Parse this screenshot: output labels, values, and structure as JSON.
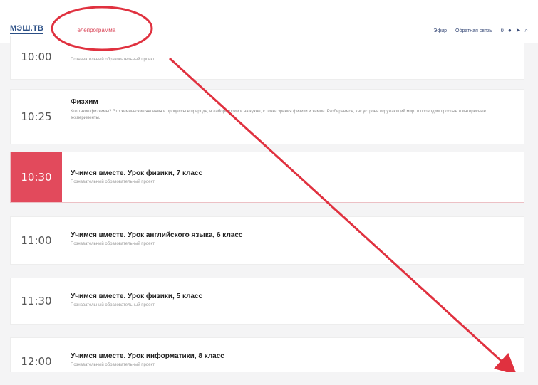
{
  "header": {
    "logo": "МЭШ.ТВ",
    "active_nav": "Телепрограмма",
    "links": [
      "Эфир",
      "Обратная связь"
    ],
    "icons": [
      "vk-icon",
      "ok-icon",
      "telegram-icon",
      "search-icon"
    ]
  },
  "colors": {
    "accent": "#e24a5c",
    "brand": "#2b4f86",
    "background": "#f4f4f5"
  },
  "schedule": [
    {
      "time": "10:00",
      "title": "",
      "subtitle": "Познавательный образовательный проект",
      "description": ""
    },
    {
      "time": "10:25",
      "title": "Физхим",
      "subtitle": "",
      "description": "Кто такие физхимы? Это химические явления и процессы в природе, в лаборатории и на кухне, с точки зрения физики и химии. Разбираемся, как устроен окружающий мир, и проводим простые и интересные эксперименты."
    },
    {
      "time": "10:30",
      "title": "Учимся вместе. Урок физики, 7 класс",
      "subtitle": "Познавательный образовательный проект",
      "description": "",
      "active": true
    },
    {
      "time": "11:00",
      "title": "Учимся вместе. Урок английского языка, 6 класс",
      "subtitle": "Познавательный образовательный проект",
      "description": ""
    },
    {
      "time": "11:30",
      "title": "Учимся вместе. Урок физики, 5 класс",
      "subtitle": "Познавательный образовательный проект",
      "description": ""
    },
    {
      "time": "12:00",
      "title": "Учимся вместе. Урок информатики, 8 класс",
      "subtitle": "Познавательный образовательный проект",
      "description": ""
    }
  ]
}
